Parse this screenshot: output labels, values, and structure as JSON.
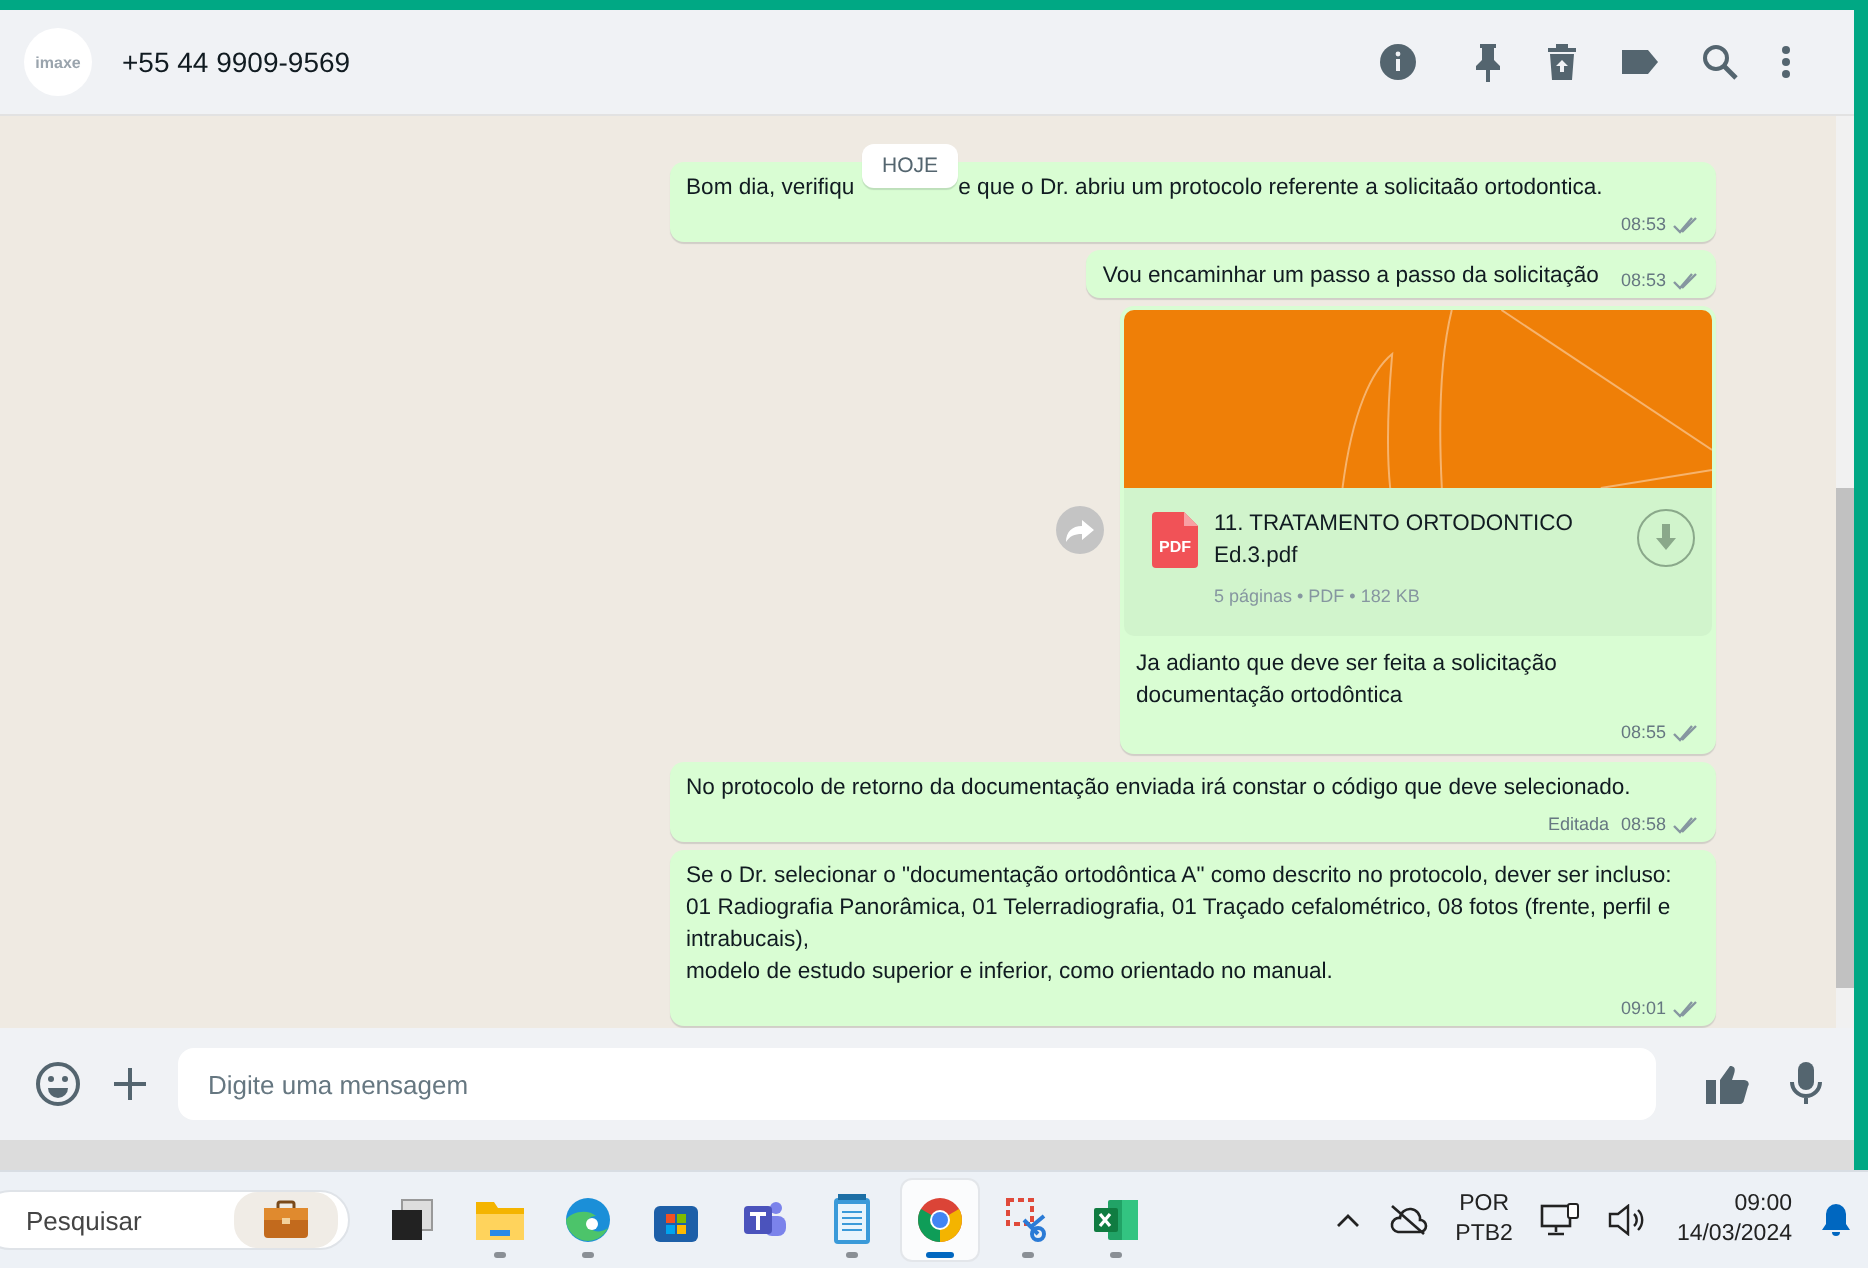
{
  "header": {
    "avatar_text": "imaxe",
    "contact": "+55 44 9909-9569"
  },
  "date_badge": "HOJE",
  "messages": [
    {
      "kind": "text",
      "parts": [
        "Bom dia, verifiqu",
        "e que o Dr. abriu um protocolo referente a solicitaão ortodontica."
      ],
      "time": "08:53"
    },
    {
      "kind": "text",
      "parts": [
        "Vou encaminhar um passo a passo da solicitação"
      ],
      "time": "08:53"
    },
    {
      "kind": "document",
      "preview": {
        "kind": "picture"
      },
      "file_name": "11. TRATAMENTO ORTODONTICO Ed.3.pdf",
      "file_type": "PDF",
      "file_info": "5 páginas • PDF • 182 KB",
      "parts": [
        "Ja adianto que deve ser feita a solicitação documentação ortodôntica"
      ],
      "time": "08:55"
    },
    {
      "kind": "text",
      "parts": [
        "No protocolo de retorno da documentação enviada irá constar o código que deve selecionado."
      ],
      "edited": "Editada",
      "time": "08:58"
    },
    {
      "kind": "text",
      "parts": [
        "Se o Dr. selecionar o \"documentação ortodôntica A\" como descrito no protocolo, dever ser incluso:\n01 Radiografia Panorâmica, 01 Telerradiografia, 01 Traçado cefalométrico, 08 fotos (frente, perfil e intrabucais),\nmodelo de estudo superior e inferior, como orientado no manual."
      ],
      "time": "09:01"
    }
  ],
  "composer": {
    "placeholder": "Digite uma mensagem"
  },
  "taskbar": {
    "search": {
      "placeholder": "Pesquisar"
    },
    "apps": [
      {
        "kind": "taskview",
        "running": false,
        "selected": false
      },
      {
        "kind": "explorer",
        "running": true,
        "selected": false
      },
      {
        "kind": "edge",
        "running": true,
        "selected": false
      },
      {
        "kind": "store",
        "running": false,
        "selected": false
      },
      {
        "kind": "teams",
        "running": false,
        "selected": false
      },
      {
        "kind": "notepad",
        "running": true,
        "selected": false
      },
      {
        "kind": "chrome",
        "running": true,
        "selected": true
      },
      {
        "kind": "snip",
        "running": true,
        "selected": false
      },
      {
        "kind": "excel",
        "running": true,
        "selected": false
      }
    ],
    "language": [
      "POR",
      "PTB2"
    ],
    "time": "09:00",
    "date": "14/03/2024"
  }
}
